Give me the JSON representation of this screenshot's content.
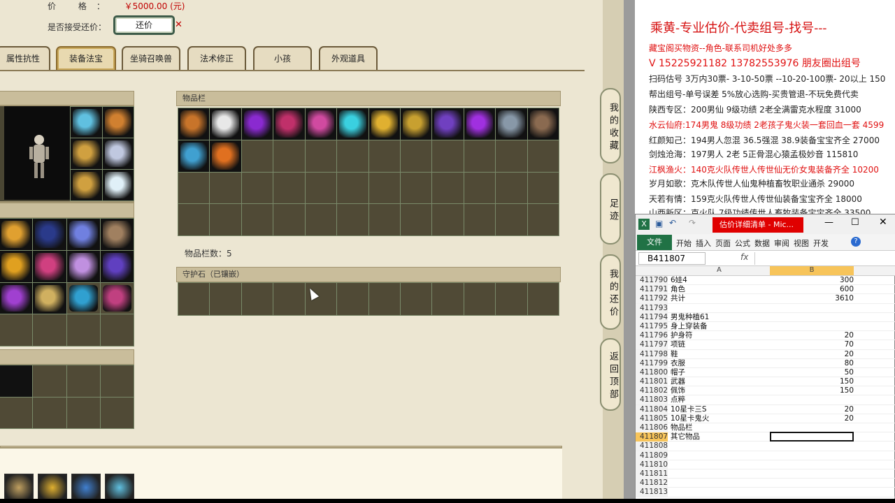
{
  "game": {
    "price_label": "价 格：",
    "price_value": "￥5000.00 (元)",
    "accept_label": "是否接受还价：",
    "counter_button": "还价",
    "tabs": [
      "属性抗性",
      "装备法宝",
      "坐骑召唤兽",
      "法术修正",
      "小孩",
      "外观道具"
    ],
    "inventory_title": "物品栏",
    "inventory_count": "物品栏数：5",
    "guard_stone_title": "守护石（已镶嵌）",
    "side_nav": [
      "我的收藏",
      "足迹",
      "我的还价",
      "返回顶部"
    ],
    "item_colors": [
      "#c8742a",
      "#e8e8e8",
      "#8a2ad0",
      "#c0306a",
      "#d04aa0",
      "#3ad0e0",
      "#e0b030",
      "#c8a030",
      "#7040c0",
      "#a030e0",
      "#8898a8",
      "#8a6a50",
      "#40a0d0",
      "#e07020"
    ]
  },
  "ad": {
    "title": "乘黄-专业估价-代卖组号-找号---",
    "lines": [
      {
        "text": "藏宝阁买物资--角色-联系司机好处多多",
        "style": "red"
      },
      {
        "text": "V 15225921182   13782553976 朋友圈出组号",
        "style": "red big"
      },
      {
        "text": "扫码估号 3万内30票- 3-10-50票  --10-20-100票- 20以上 150",
        "style": ""
      },
      {
        "text": "帮出组号-单号误差 5%放心选购-买贵管退-不玩免费代卖",
        "style": ""
      },
      {
        "text": "陕西专区：200男仙 9级功绩 2老全满雷克水程度 31000",
        "style": ""
      },
      {
        "text": "水云仙府:174男鬼 8级功绩 2老孩子鬼火装一套回血一套 4599",
        "style": "red"
      },
      {
        "text": "红颜知己：194男人忽混 36.5强混 38.9装备宝宝齐全 27000",
        "style": ""
      },
      {
        "text": "剑烛沧海：197男人 2老 5正骨混心猿孟极妙音 115810",
        "style": ""
      },
      {
        "text": "江枫渔火：140克火队传世人传世仙无价女鬼装备齐全 10200",
        "style": "red"
      },
      {
        "text": "岁月如歌：克木队传世人仙鬼种植畜牧职业通杀 29000",
        "style": ""
      },
      {
        "text": "天若有情：159克火队传世人传世仙装备宝宝齐全 18000",
        "style": ""
      },
      {
        "text": "山西新区：克火队 7级功绩传世人畜牧装备宝宝齐全 33500",
        "style": ""
      }
    ]
  },
  "excel": {
    "doc_title": "估价详细清单 - Mic...",
    "file_tab": "文件",
    "ribbon_tabs": [
      "开始",
      "插入",
      "页面",
      "公式",
      "数据",
      "审阅",
      "视图",
      "开发"
    ],
    "name_box": "B411807",
    "fx": "fx",
    "col_a": "A",
    "col_b": "B",
    "rows": [
      {
        "n": "411790",
        "a": "6娃4",
        "b": "300"
      },
      {
        "n": "411791",
        "a": "角色",
        "b": "600"
      },
      {
        "n": "411792",
        "a": "共计",
        "b": "3610"
      },
      {
        "n": "411793",
        "a": "",
        "b": ""
      },
      {
        "n": "411794",
        "a": "男鬼种植61",
        "b": ""
      },
      {
        "n": "411795",
        "a": "身上穿装备",
        "b": ""
      },
      {
        "n": "411796",
        "a": "护身符",
        "b": "20"
      },
      {
        "n": "411797",
        "a": "项链",
        "b": "70"
      },
      {
        "n": "411798",
        "a": "鞋",
        "b": "20"
      },
      {
        "n": "411799",
        "a": "衣服",
        "b": "80"
      },
      {
        "n": "411800",
        "a": "帽子",
        "b": "50"
      },
      {
        "n": "411801",
        "a": "武器",
        "b": "150"
      },
      {
        "n": "411802",
        "a": "佩饰",
        "b": "150"
      },
      {
        "n": "411803",
        "a": "点粹",
        "b": ""
      },
      {
        "n": "411804",
        "a": "10星卡三S",
        "b": "20"
      },
      {
        "n": "411805",
        "a": "10星卡鬼火",
        "b": "20"
      },
      {
        "n": "411806",
        "a": "物品栏",
        "b": ""
      },
      {
        "n": "411807",
        "a": "其它物品",
        "b": ""
      },
      {
        "n": "411808",
        "a": "",
        "b": ""
      },
      {
        "n": "411809",
        "a": "",
        "b": ""
      },
      {
        "n": "411810",
        "a": "",
        "b": ""
      },
      {
        "n": "411811",
        "a": "",
        "b": ""
      },
      {
        "n": "411812",
        "a": "",
        "b": ""
      },
      {
        "n": "411813",
        "a": "",
        "b": ""
      }
    ],
    "selected_row": "411807"
  }
}
